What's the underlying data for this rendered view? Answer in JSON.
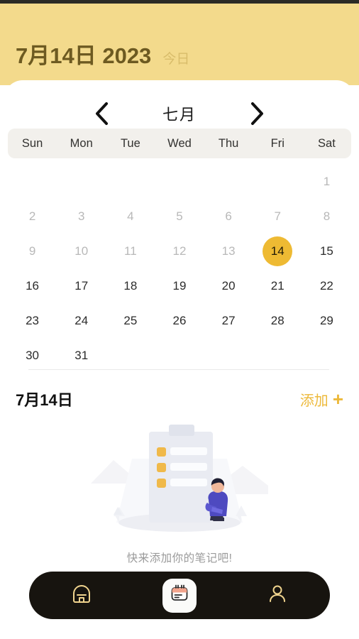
{
  "app": {
    "accent_yellow": "#f3da8c",
    "accent_gold": "#eeba33",
    "nav_dark": "#17140f"
  },
  "header": {
    "date_title": "7月14日 2023",
    "today_label": "今日"
  },
  "calendar": {
    "prev_label": "‹",
    "next_label": "›",
    "month_label": "七月",
    "weekdays": [
      "Sun",
      "Mon",
      "Tue",
      "Wed",
      "Thu",
      "Fri",
      "Sat"
    ],
    "leading_blanks": 6,
    "days": [
      {
        "n": "1",
        "state": "muted"
      },
      {
        "n": "2",
        "state": "muted"
      },
      {
        "n": "3",
        "state": "muted"
      },
      {
        "n": "4",
        "state": "muted"
      },
      {
        "n": "5",
        "state": "muted"
      },
      {
        "n": "6",
        "state": "muted"
      },
      {
        "n": "7",
        "state": "muted"
      },
      {
        "n": "8",
        "state": "muted"
      },
      {
        "n": "9",
        "state": "muted"
      },
      {
        "n": "10",
        "state": "muted"
      },
      {
        "n": "11",
        "state": "muted"
      },
      {
        "n": "12",
        "state": "muted"
      },
      {
        "n": "13",
        "state": "muted"
      },
      {
        "n": "14",
        "state": "selected"
      },
      {
        "n": "15",
        "state": "normal"
      },
      {
        "n": "16",
        "state": "normal"
      },
      {
        "n": "17",
        "state": "normal"
      },
      {
        "n": "18",
        "state": "normal"
      },
      {
        "n": "19",
        "state": "normal"
      },
      {
        "n": "20",
        "state": "normal"
      },
      {
        "n": "21",
        "state": "normal"
      },
      {
        "n": "22",
        "state": "normal"
      },
      {
        "n": "23",
        "state": "normal"
      },
      {
        "n": "24",
        "state": "normal"
      },
      {
        "n": "25",
        "state": "normal"
      },
      {
        "n": "26",
        "state": "normal"
      },
      {
        "n": "27",
        "state": "normal"
      },
      {
        "n": "28",
        "state": "normal"
      },
      {
        "n": "29",
        "state": "normal"
      },
      {
        "n": "30",
        "state": "normal"
      },
      {
        "n": "31",
        "state": "normal"
      }
    ]
  },
  "notes": {
    "date_label": "7月14日",
    "add_label": "添加",
    "add_plus": "+",
    "empty_caption": "快来添加你的笔记吧!"
  },
  "bottom_nav": {
    "items": [
      {
        "name": "home-icon",
        "active": false
      },
      {
        "name": "notebook-icon",
        "active": true
      },
      {
        "name": "profile-icon",
        "active": false
      }
    ]
  }
}
